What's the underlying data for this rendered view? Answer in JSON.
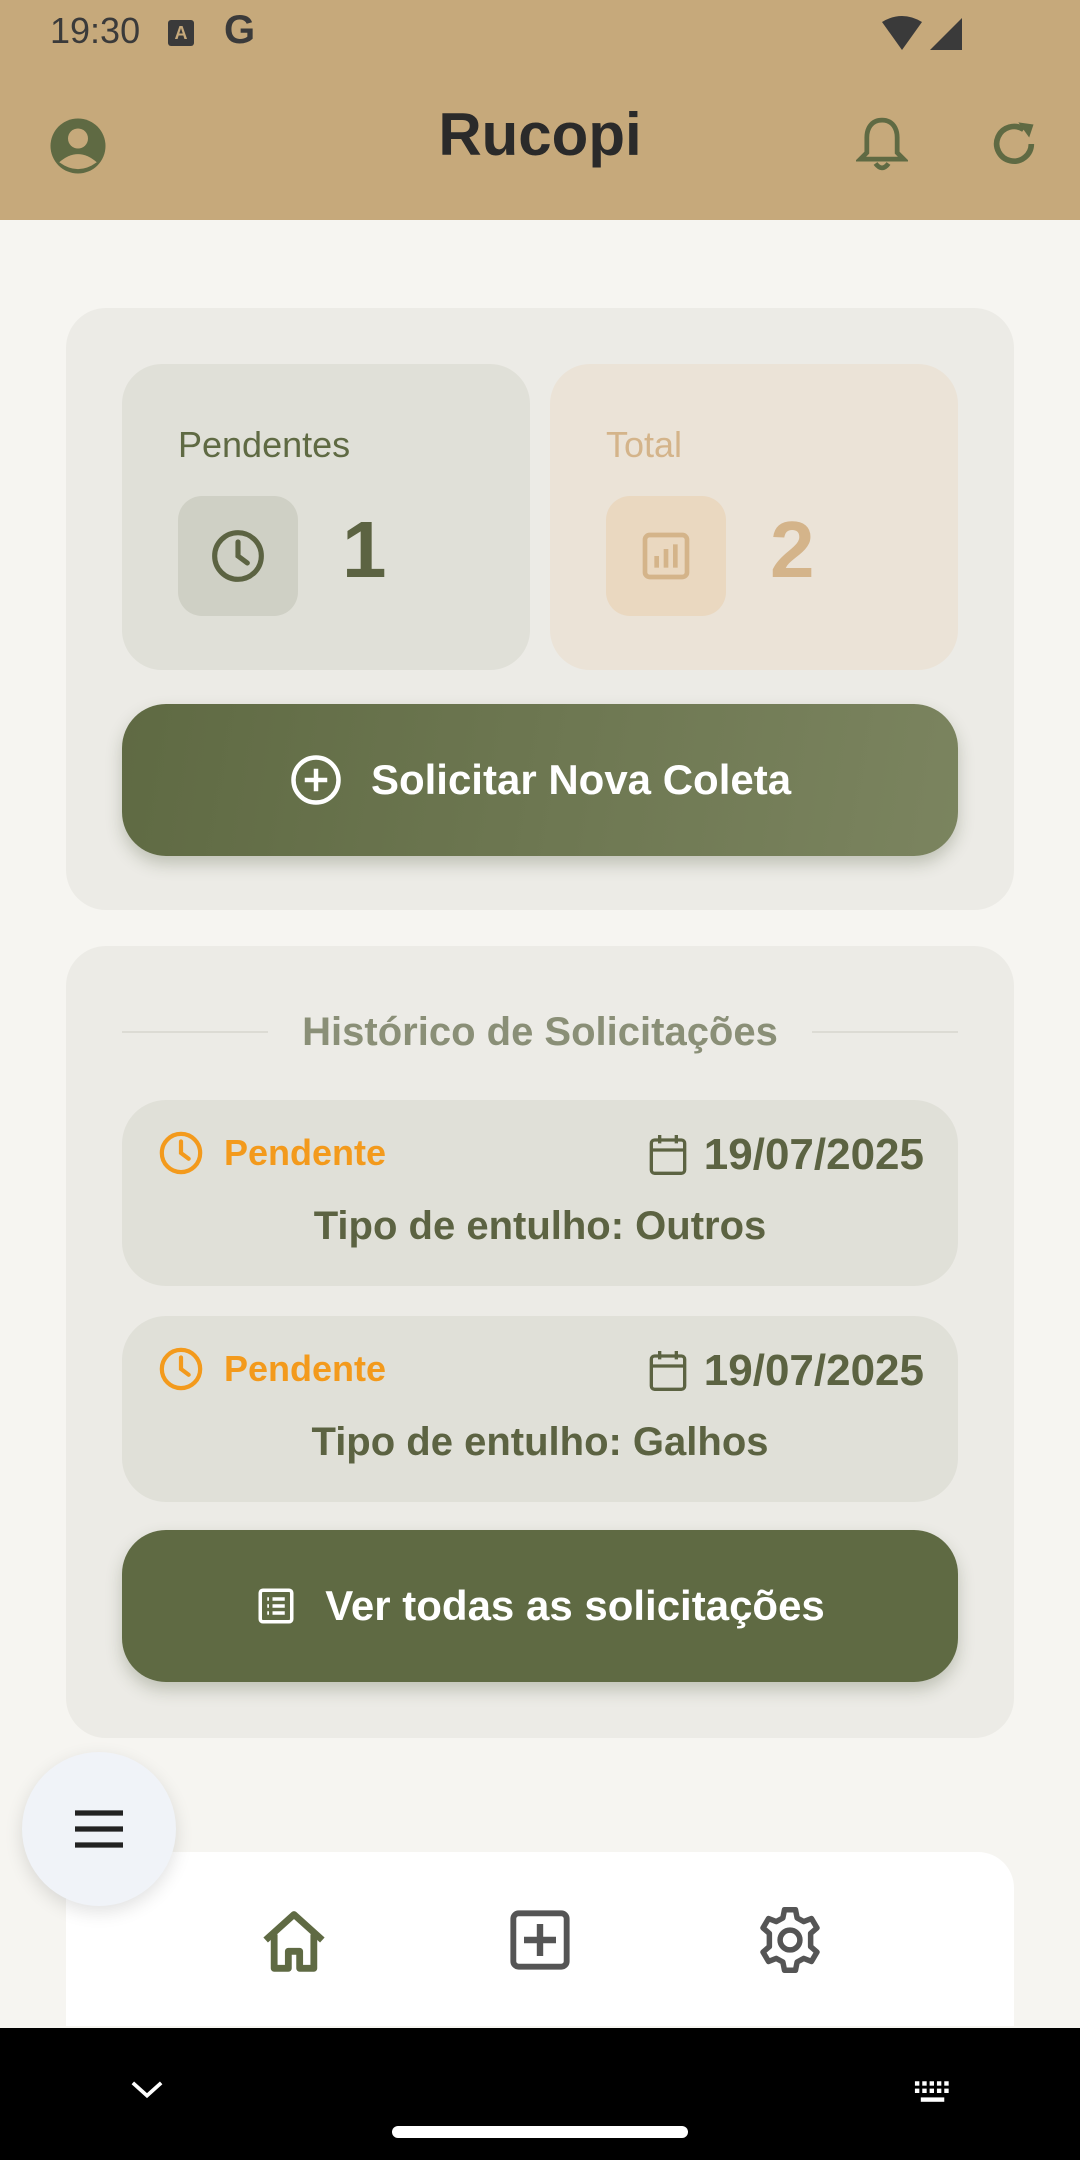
{
  "status_bar": {
    "time": "19:30",
    "a_icon_letter": "A",
    "g_icon_letter": "G"
  },
  "app_bar": {
    "title": "Rucopi",
    "icons": [
      "account-circle-icon",
      "bell-icon",
      "refresh-icon"
    ]
  },
  "stats": {
    "pending": {
      "label": "Pendentes",
      "value": "1",
      "icon": "clock-icon"
    },
    "total": {
      "label": "Total",
      "value": "2",
      "icon": "chart-icon"
    }
  },
  "new_request_button": {
    "label": "Solicitar Nova Coleta",
    "icon": "plus-circle-icon"
  },
  "history": {
    "title": "Histórico de Solicitações",
    "items": [
      {
        "status": "Pendente",
        "date": "19/07/2025",
        "type": "Tipo de entulho: Outros"
      },
      {
        "status": "Pendente",
        "date": "19/07/2025",
        "type": "Tipo de entulho: Galhos"
      }
    ],
    "view_all_button": {
      "label": "Ver todas as solicitações",
      "icon": "list-icon"
    }
  },
  "fab": {
    "icon": "menu-icon"
  },
  "bottom_nav": {
    "items": [
      "home-icon",
      "add-box-icon",
      "settings-icon"
    ]
  },
  "colors": {
    "app_bar": "#c6a97b",
    "primary_green": "#5f6a43",
    "pending_orange": "#f39a1c",
    "total_tan": "#d4b48a"
  }
}
